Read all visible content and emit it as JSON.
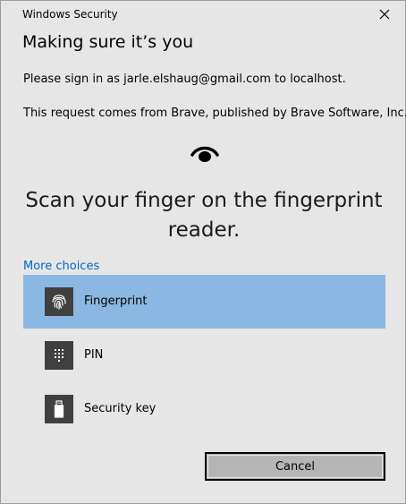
{
  "window": {
    "title": "Windows Security",
    "close_icon": "close-icon"
  },
  "content": {
    "heading": "Making sure it’s you",
    "sign_in_text": "Please sign in as jarle.elshaug@gmail.com to localhost.",
    "request_text": "This request comes from Brave, published by Brave Software, Inc..",
    "status_icon": "eye-icon",
    "scan_message": "Scan your finger on the fingerprint reader."
  },
  "choices": {
    "link_label": "More choices",
    "items": [
      {
        "label": "Fingerprint",
        "icon": "fingerprint-icon",
        "selected": true
      },
      {
        "label": "PIN",
        "icon": "pin-keypad-icon",
        "selected": false
      },
      {
        "label": "Security key",
        "icon": "security-key-icon",
        "selected": false
      }
    ]
  },
  "footer": {
    "cancel_label": "Cancel"
  },
  "colors": {
    "background": "#e6e6e6",
    "selected": "#8bb8e2",
    "link": "#0067c0",
    "icon_tile": "#404040",
    "button": "#b5b5b5"
  }
}
